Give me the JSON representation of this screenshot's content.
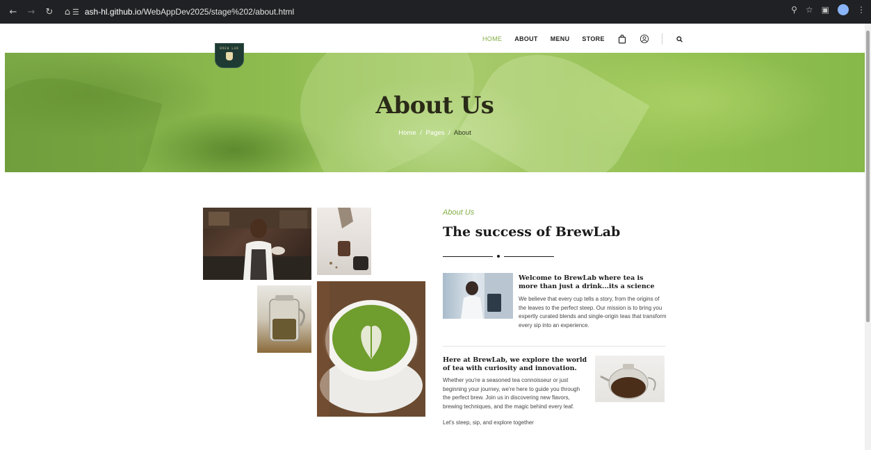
{
  "browser": {
    "url_host": "ash-hl.github.io",
    "url_path": "/WebAppDev2025/stage%202/about.html"
  },
  "brand": {
    "logo_text": "BREW LAB"
  },
  "nav": {
    "items": [
      {
        "label": "HOME",
        "active": true
      },
      {
        "label": "ABOUT",
        "active": false
      },
      {
        "label": "MENU",
        "active": false
      },
      {
        "label": "STORE",
        "active": false
      }
    ],
    "icons": [
      "bag-icon",
      "profile-icon",
      "search-icon"
    ]
  },
  "hero": {
    "title": "About Us",
    "breadcrumb": {
      "home": "Home",
      "sep": "/",
      "pages": "Pages",
      "current": "About"
    }
  },
  "about": {
    "eyebrow": "About Us",
    "title": "The success of BrewLab",
    "feature1": {
      "title": "Welcome to BrewLab where tea is more than just a drink...its a science",
      "text": "We believe that every cup tells a story, from the origins of the leaves to the perfect steep. Our mission is to bring you expertly curated blends and single-origin teas that transform every sip into an experience."
    },
    "feature2": {
      "title": "Here at BrewLab, we explore the world of tea with curiosity and innovation.",
      "text": "Whether you're a seasoned tea connoisseur or just beginning your journey, we're here to guide you through the perfect brew. Join us in discovering new flavors, brewing techniques, and the magic behind every leaf.",
      "closing": "Let's steep, sip, and explore together"
    }
  },
  "colors": {
    "accent": "#82ae46",
    "chrome": "#202124",
    "heading": "#1a1a1a"
  }
}
